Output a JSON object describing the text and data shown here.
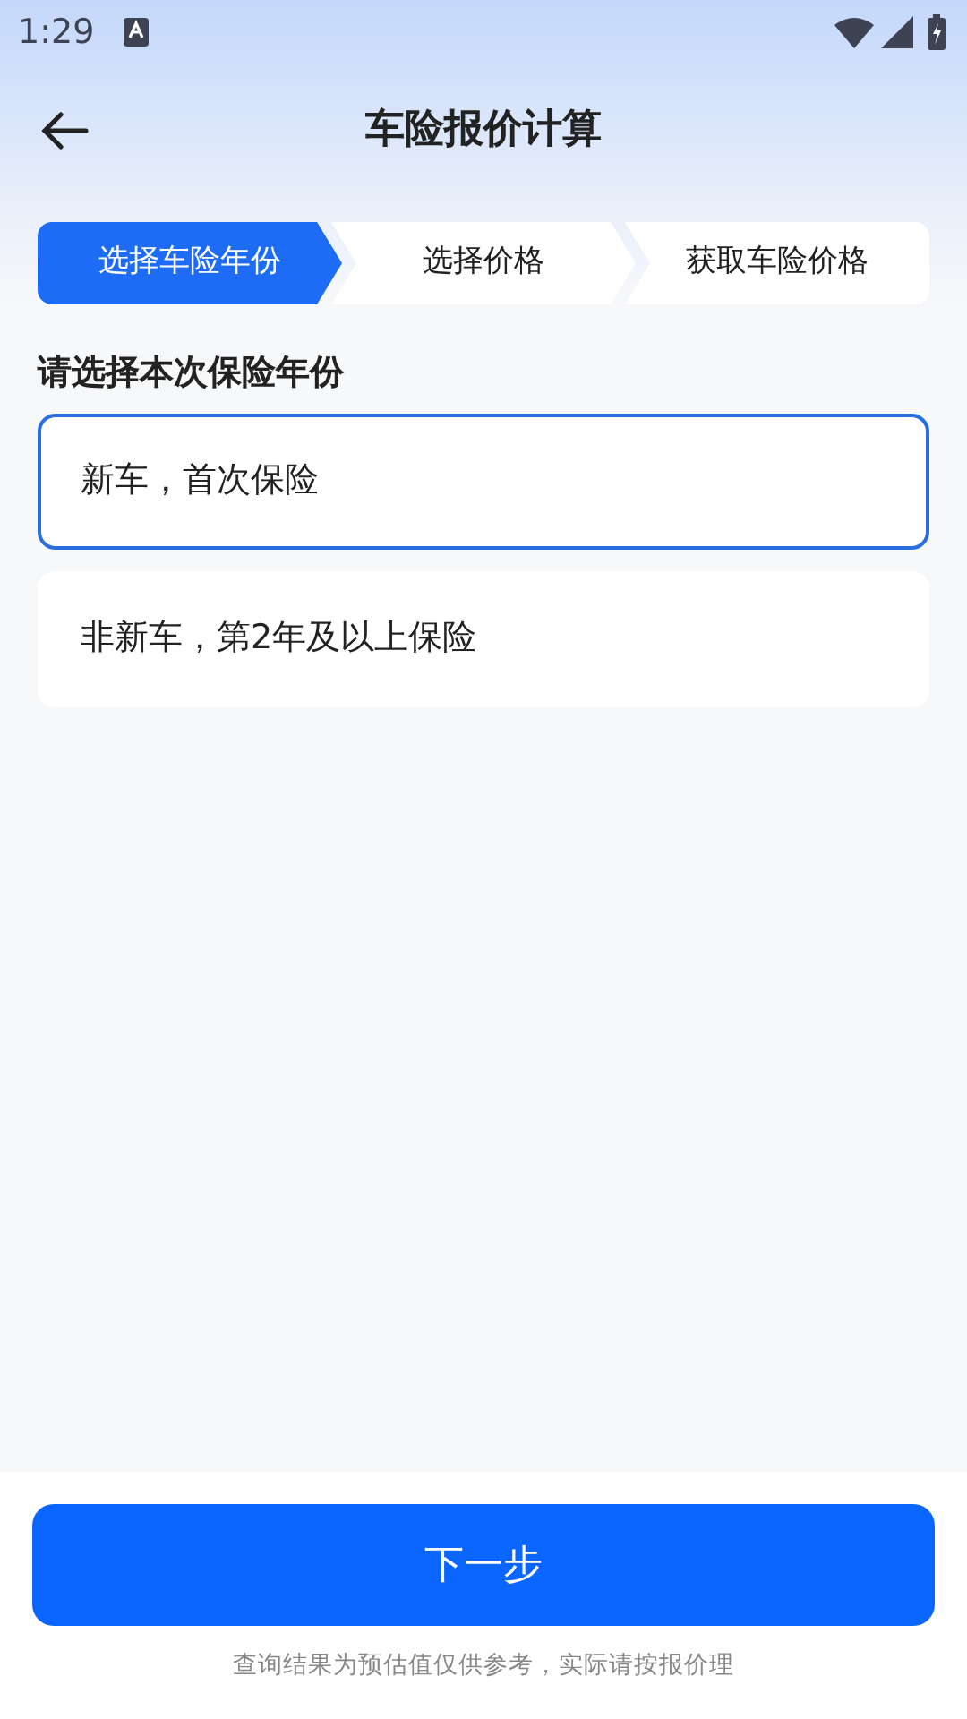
{
  "status_bar": {
    "time": "1:29"
  },
  "header": {
    "title": "车险报价计算"
  },
  "steps": [
    {
      "label": "选择车险年份",
      "selected": true
    },
    {
      "label": "选择价格",
      "selected": false
    },
    {
      "label": "获取车险价格",
      "selected": false
    }
  ],
  "section_title": "请选择本次保险年份",
  "options": [
    {
      "label": "新车，首次保险",
      "selected": true
    },
    {
      "label": "非新车，第2年及以上保险",
      "selected": false
    }
  ],
  "next_button": "下一步",
  "footer_note": "查询结果为预估值仅供参考，实际请按报价理"
}
